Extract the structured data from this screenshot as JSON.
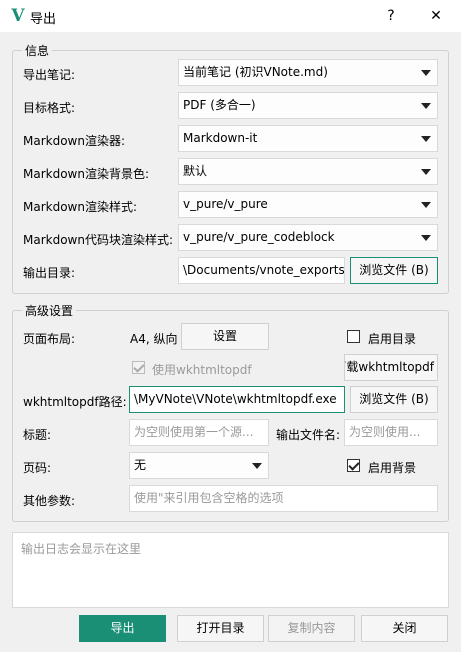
{
  "window": {
    "title": "导出",
    "help_label": "?",
    "close_label": "✕",
    "logo_glyph": "V"
  },
  "info": {
    "group_title": "信息",
    "rows": [
      {
        "label": "导出笔记:",
        "value": "当前笔记 (初识VNote.md)"
      },
      {
        "label": "目标格式:",
        "value": "PDF (多合一)"
      },
      {
        "label": "Markdown渲染器:",
        "value": "Markdown-it"
      },
      {
        "label": "Markdown渲染背景色:",
        "value": "默认"
      },
      {
        "label": "Markdown渲染样式:",
        "value": "v_pure/v_pure"
      },
      {
        "label": "Markdown代码块渲染样式:",
        "value": "v_pure/v_pure_codeblock"
      }
    ],
    "output_dir_label": "输出目录:",
    "output_dir_value": "\\Documents/vnote_exports",
    "browse_label": "浏览文件 (B)"
  },
  "advanced": {
    "group_title": "高级设置",
    "page_layout_label": "页面布局:",
    "page_layout_value": "A4, 纵向",
    "settings_button": "设置",
    "enable_toc_label": "启用目录",
    "use_wkhtml_label": "使用wkhtmltopdf",
    "download_wkhtml_label": "下载wkhtmltopdf",
    "wkhtml_path_label": "wkhtmltopdf路径:",
    "wkhtml_path_value": "\\MyVNote\\VNote\\wkhtmltopdf.exe",
    "browse_label": "浏览文件 (B)",
    "title_label": "标题:",
    "title_placeholder": "为空则使用第一个源...",
    "output_name_label": "输出文件名:",
    "output_name_placeholder": "为空则使用...",
    "page_number_label": "页码:",
    "page_number_value": "无",
    "enable_background_label": "启用背景",
    "other_args_label": "其他参数:",
    "other_args_placeholder": "使用\"来引用包含空格的选项"
  },
  "log": {
    "placeholder": "输出日志会显示在这里"
  },
  "buttons": {
    "export": "导出",
    "open_dir": "打开目录",
    "copy_content": "复制内容",
    "close": "关闭"
  },
  "colors": {
    "accent": "#1a8f76"
  }
}
